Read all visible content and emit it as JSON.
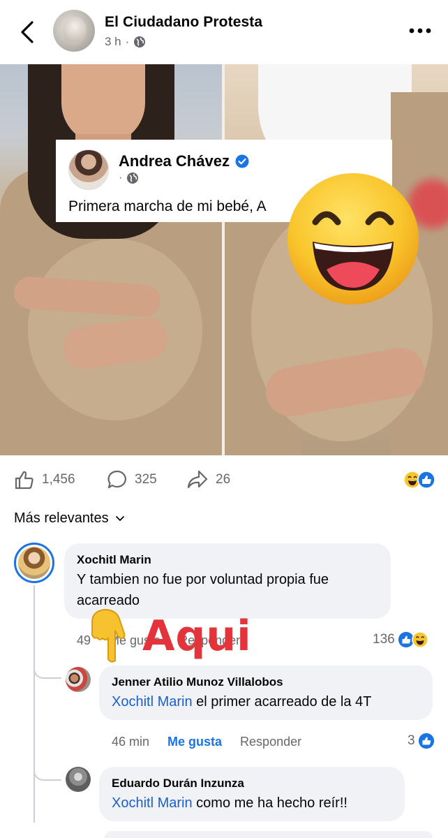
{
  "header": {
    "page_name": "El Ciudadano Protesta",
    "time": "3 h",
    "back_icon": "chevron-left-icon",
    "more_icon": "more-horizontal-icon",
    "privacy_icon": "globe-icon"
  },
  "embedded_post": {
    "author": "Andrea Chávez",
    "verified_icon": "verified-badge-icon",
    "privacy_icon": "globe-icon",
    "text": "Primera marcha de mi bebé, A"
  },
  "overlay_emoji": "grinning-squinting-face-icon",
  "stats": {
    "likes": "1,456",
    "comments": "325",
    "shares": "26",
    "like_icon": "thumbs-up-icon",
    "comment_icon": "comment-bubble-icon",
    "share_icon": "share-arrow-icon"
  },
  "sort_label": "Más relevantes",
  "comments": [
    {
      "author": "Xochitl Marin",
      "text": "Y tambien no fue por voluntad propia fue acarreado",
      "time": "49",
      "like_label": "Me gusta",
      "reply_label": "Responder",
      "reaction_count": "136"
    },
    {
      "author": "Jenner Atilio Munoz Villalobos",
      "mention": "Xochitl Marin",
      "text": " el primer acarreado de la 4T",
      "time": "46 min",
      "like_label": "Me gusta",
      "reply_label": "Responder",
      "reaction_count": "3"
    },
    {
      "author": "Eduardo Durán Inzunza",
      "mention": "Xochitl Marin",
      "text": " como me ha hecho reír!!"
    }
  ],
  "annotation": {
    "text": "Aqui",
    "pointer_icon": "pointing-down-hand-icon"
  },
  "colors": {
    "link_blue": "#1b5fcf",
    "like_blue": "#1b74e4",
    "annotation_red": "#e4343b",
    "bubble_gray": "#f0f2f5"
  }
}
